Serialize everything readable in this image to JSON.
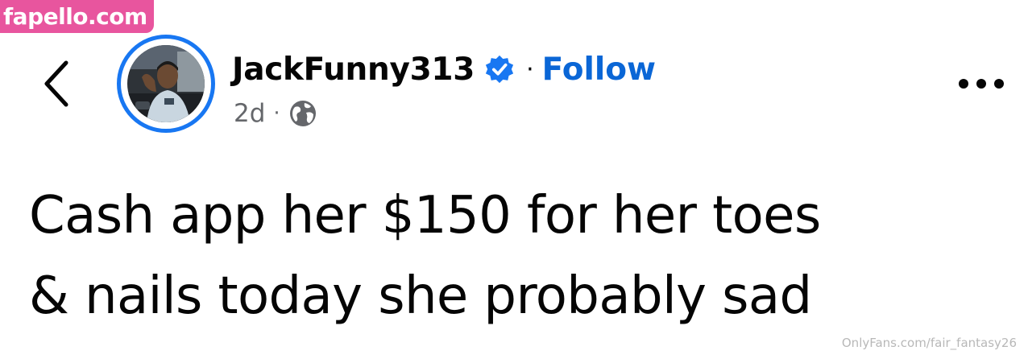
{
  "watermark": {
    "site": "fapello.com",
    "bottom": "OnlyFans.com/fair_fantasy26",
    "site_bg_color": "#e8559e"
  },
  "header": {
    "back_icon": "chevron-left-icon",
    "avatar_alt": "profile photo",
    "username": "JackFunny313",
    "verified_icon": "verified-badge-icon",
    "separator": "·",
    "follow_label": "Follow",
    "timestamp": "2d",
    "meta_separator": "·",
    "audience_icon": "globe-icon",
    "more_icon": "more-options-icon"
  },
  "post": {
    "line1": "Cash app her $150 for her toes",
    "line2": "& nails today she probably sad"
  },
  "colors": {
    "accent": "#1877f2",
    "follow": "#0a66d6",
    "text": "#050505",
    "secondary": "#65676b"
  }
}
